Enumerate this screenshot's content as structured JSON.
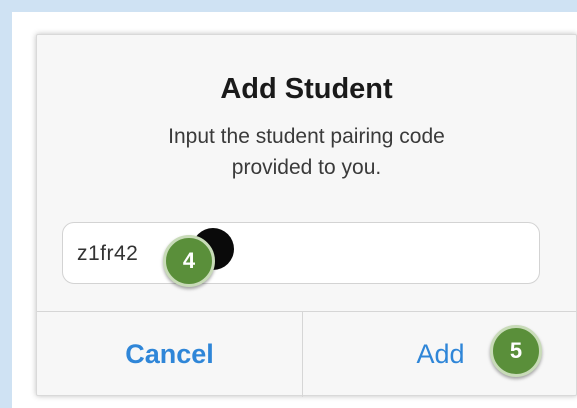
{
  "dialog": {
    "title": "Add Student",
    "message_line1": "Input the student pairing code",
    "message_line2": "provided to you.",
    "code_value": "z1fr42",
    "cancel_label": "Cancel",
    "add_label": "Add"
  },
  "annotations": {
    "step4": "4",
    "step5": "5"
  },
  "colors": {
    "background": "#cfe2f3",
    "dialog_background": "#f7f7f7",
    "button_text": "#2f86d8",
    "badge": "#5a8f3a",
    "caret": "#2f7fe6"
  }
}
